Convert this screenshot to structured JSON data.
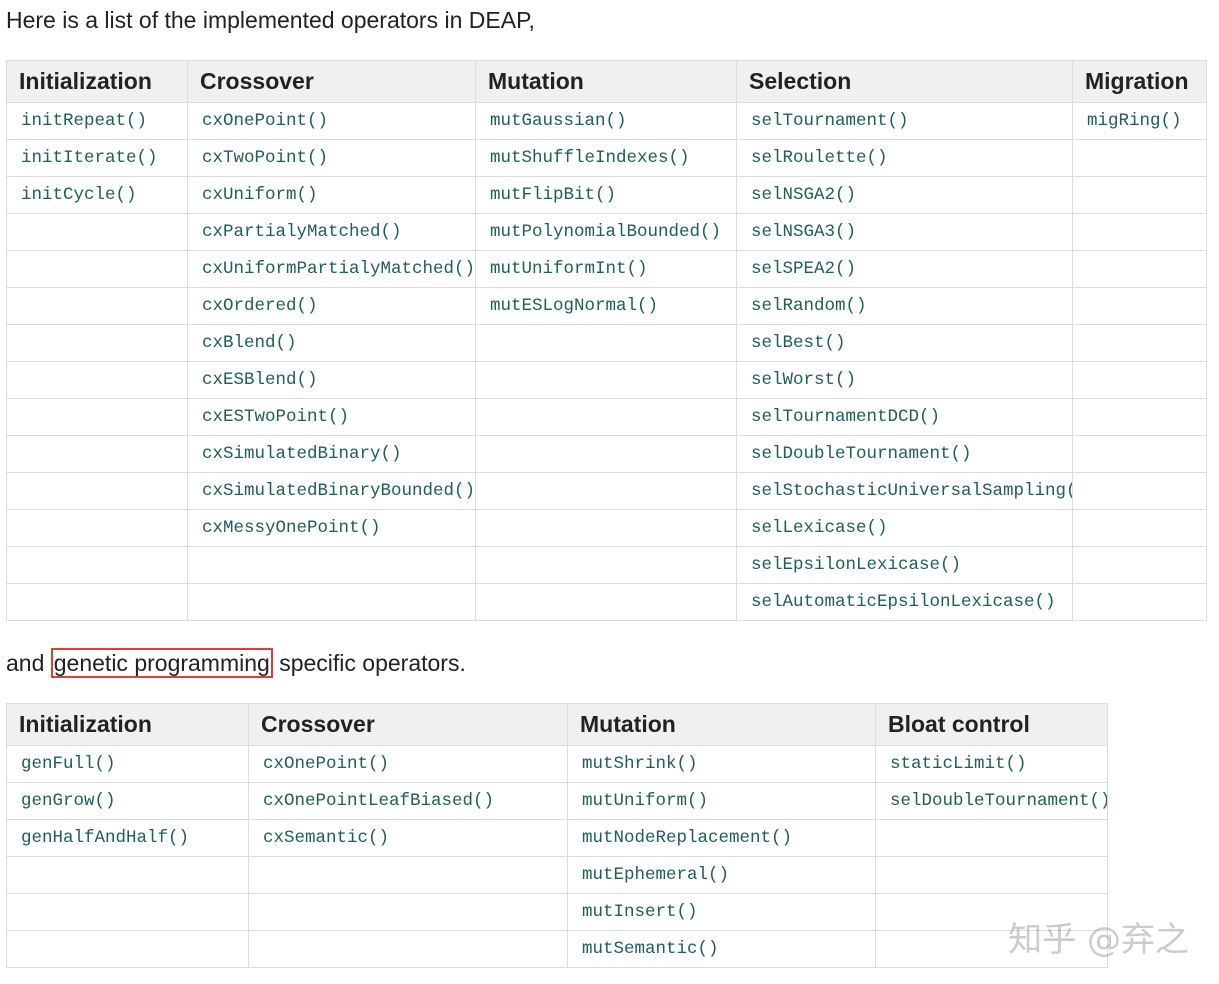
{
  "intro_text": "Here is a list of the implemented operators in DEAP,",
  "gp_text": {
    "before": "and ",
    "highlight": "genetic programming",
    "after": " specific operators."
  },
  "highlight_color": "#d9403a",
  "code_color": "#1f5f5a",
  "table1": {
    "headers": [
      "Initialization",
      "Crossover",
      "Mutation",
      "Selection",
      "Migration"
    ],
    "rows": [
      [
        "initRepeat()",
        "cxOnePoint()",
        "mutGaussian()",
        "selTournament()",
        "migRing()"
      ],
      [
        "initIterate()",
        "cxTwoPoint()",
        "mutShuffleIndexes()",
        "selRoulette()",
        ""
      ],
      [
        "initCycle()",
        "cxUniform()",
        "mutFlipBit()",
        "selNSGA2()",
        ""
      ],
      [
        "",
        "cxPartialyMatched()",
        "mutPolynomialBounded()",
        "selNSGA3()",
        ""
      ],
      [
        "",
        "cxUniformPartialyMatched()",
        "mutUniformInt()",
        "selSPEA2()",
        ""
      ],
      [
        "",
        "cxOrdered()",
        "mutESLogNormal()",
        "selRandom()",
        ""
      ],
      [
        "",
        "cxBlend()",
        "",
        "selBest()",
        ""
      ],
      [
        "",
        "cxESBlend()",
        "",
        "selWorst()",
        ""
      ],
      [
        "",
        "cxESTwoPoint()",
        "",
        "selTournamentDCD()",
        ""
      ],
      [
        "",
        "cxSimulatedBinary()",
        "",
        "selDoubleTournament()",
        ""
      ],
      [
        "",
        "cxSimulatedBinaryBounded()",
        "",
        "selStochasticUniversalSampling()",
        ""
      ],
      [
        "",
        "cxMessyOnePoint()",
        "",
        "selLexicase()",
        ""
      ],
      [
        "",
        "",
        "",
        "selEpsilonLexicase()",
        ""
      ],
      [
        "",
        "",
        "",
        "selAutomaticEpsilonLexicase()",
        ""
      ]
    ]
  },
  "table2": {
    "headers": [
      "Initialization",
      "Crossover",
      "Mutation",
      "Bloat control"
    ],
    "rows": [
      [
        "genFull()",
        "cxOnePoint()",
        "mutShrink()",
        "staticLimit()"
      ],
      [
        "genGrow()",
        "cxOnePointLeafBiased()",
        "mutUniform()",
        "selDoubleTournament()"
      ],
      [
        "genHalfAndHalf()",
        "cxSemantic()",
        "mutNodeReplacement()",
        ""
      ],
      [
        "",
        "",
        "mutEphemeral()",
        ""
      ],
      [
        "",
        "",
        "mutInsert()",
        ""
      ],
      [
        "",
        "",
        "mutSemantic()",
        ""
      ]
    ]
  },
  "watermark": "知乎 @弃之"
}
